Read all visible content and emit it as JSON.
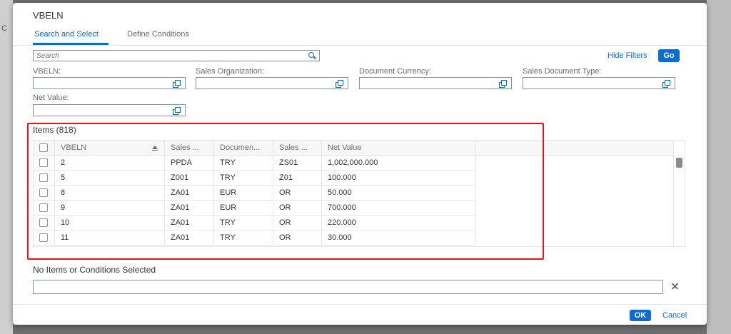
{
  "backdrop": {
    "fragment": "C"
  },
  "dialog": {
    "title": "VBELN",
    "tabs": [
      {
        "label": "Search and Select",
        "active": true
      },
      {
        "label": "Define Conditions",
        "active": false
      }
    ],
    "search": {
      "placeholder": "Search"
    },
    "hide_filters_label": "Hide Filters",
    "go_label": "Go",
    "filters": [
      {
        "label": "VBELN:"
      },
      {
        "label": "Sales Organization:"
      },
      {
        "label": "Document Currency:"
      },
      {
        "label": "Sales Document Type:"
      },
      {
        "label": "Net Value:"
      }
    ],
    "items_title": "Items (818)",
    "table": {
      "columns": [
        "VBELN",
        "Sales ...",
        "Documen...",
        "Sales ...",
        "Net Value"
      ],
      "rows": [
        [
          "2",
          "PPDA",
          "TRY",
          "ZS01",
          "1,002,000.000"
        ],
        [
          "5",
          "Z001",
          "TRY",
          "Z01",
          "100.000"
        ],
        [
          "8",
          "ZA01",
          "EUR",
          "OR",
          "50.000"
        ],
        [
          "9",
          "ZA01",
          "EUR",
          "OR",
          "700.000"
        ],
        [
          "10",
          "ZA01",
          "TRY",
          "OR",
          "220.000"
        ],
        [
          "11",
          "ZA01",
          "TRY",
          "OR",
          "30.000"
        ]
      ]
    },
    "no_items_label": "No Items or Conditions Selected",
    "ok_label": "OK",
    "cancel_label": "Cancel"
  },
  "colors": {
    "accent": "#0a6ed1",
    "highlight_box": "#e0161b"
  }
}
